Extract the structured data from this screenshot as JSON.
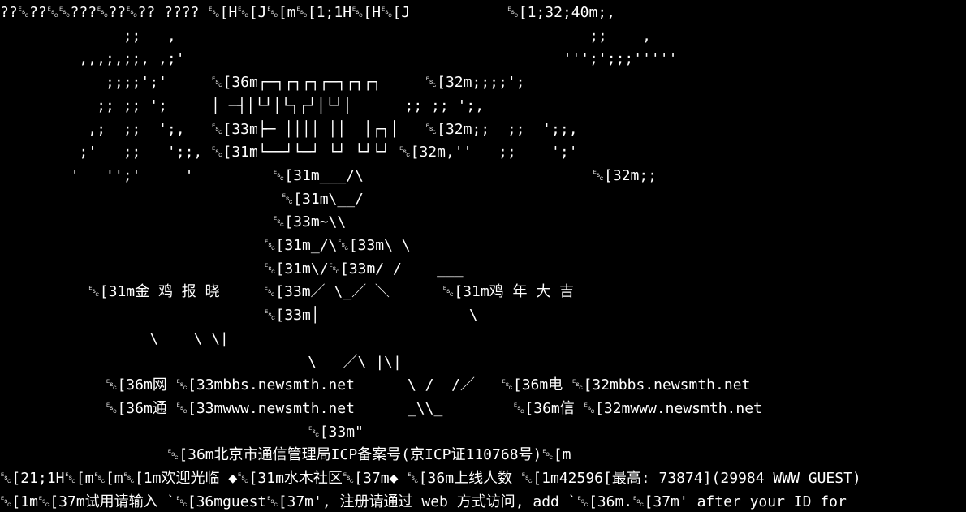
{
  "terminal": {
    "lines": [
      "??\u0000??\u0000\u0000???\u0000??\u0000?? ???? \u0000[H\u0000[J\u0000[m\u0000[1;1H\u0000[H\u0000[J           \u0000[1;32;40m;,",
      "              ;;   ,                                               ;;    ,",
      "         ,,,;,;;, ,;'                                           ''';';;;'''''",
      "            ;;;;';'     \u0000[36m┌─┐┌┐┌┐┌─┐┌┐┌┐     \u0000[32m;;;;';",
      "           ;; ;; ';     │ ─┤│└┘│└┐┌┘│└┘│      ;; ;; ';,",
      "          ,;  ;;  ';,   \u0000[33m├─ ││││ ││  │┌┐│   \u0000[32m;;  ;;  ';;,",
      "         ;'   ;;   ';;, \u0000[31m└──┘└─┘ └┘ └┘└┘ \u0000[32m,''   ;;    ';'",
      "        '   '';'     '         \u0000[31m___/\\                          \u0000[32m;;",
      "                                \u0000[31m\\__/",
      "                               \u0000[33m~\\\\",
      "                              \u0000[31m_/\\\u0000[33m\\ \\",
      "                              \u0000[31m\\/\u0000[33m/ /    ___",
      "          \u0000[31m金 鸡 报 晓     \u0000[33m／ \\_／ ＼      \u0000[31m鸡 年 大 吉",
      "                              \u0000[33m│                 \\",
      "                 \\    \\ \\|",
      "                                   \\   ／\\ |\\|",
      "            \u0000[36m网 \u0000[33mbbs.newsmth.net      \\ /  /／   \u0000[36m电 \u0000[32mbbs.newsmth.net",
      "            \u0000[36m通 \u0000[33mwww.newsmth.net      _\\\\_        \u0000[36m信 \u0000[32mwww.newsmth.net",
      "                                   \u0000[33m\"",
      "                   \u0000[36m北京市通信管理局ICP备案号(京ICP证110768号)\u0000[m",
      "\u0000[21;1H\u0000[m\u0000[m\u0000[1m欢迎光临 ◆\u0000[31m水木社区\u0000[37m◆ \u0000[36m上线人数 \u0000[1m42596[最高: 73874](29984 WWW GUEST)",
      "\u0000[1m\u0000[37m试用请输入 `\u0000[36mguest\u0000[37m', 注册请通过 web 方式访问, add `\u0000[36m.\u0000[37m' after your ID for"
    ]
  }
}
